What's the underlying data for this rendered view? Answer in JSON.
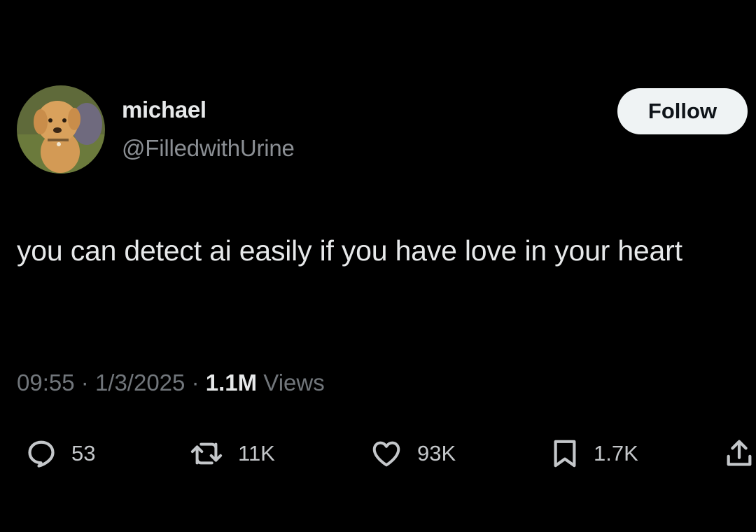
{
  "author": {
    "display_name": "michael",
    "handle": "@FilledwithUrine",
    "avatar_icon": "avatar-plush-dog"
  },
  "follow_button": {
    "label": "Follow"
  },
  "tweet": {
    "text": "you can detect ai easily if you have love in your heart"
  },
  "meta": {
    "time": "09:55",
    "separator": "·",
    "date": "1/3/2025",
    "views_count": "1.1M",
    "views_label": "Views"
  },
  "actions": {
    "reply": {
      "icon": "reply-icon",
      "count": "53"
    },
    "retweet": {
      "icon": "retweet-icon",
      "count": "11K"
    },
    "like": {
      "icon": "heart-icon",
      "count": "93K"
    },
    "bookmark": {
      "icon": "bookmark-icon",
      "count": "1.7K"
    },
    "share": {
      "icon": "share-icon"
    }
  },
  "colors": {
    "background": "#000000",
    "primary_text": "#e7e9ea",
    "secondary_text": "#71767b",
    "follow_bg": "#eff3f4",
    "follow_text": "#0f1419"
  }
}
